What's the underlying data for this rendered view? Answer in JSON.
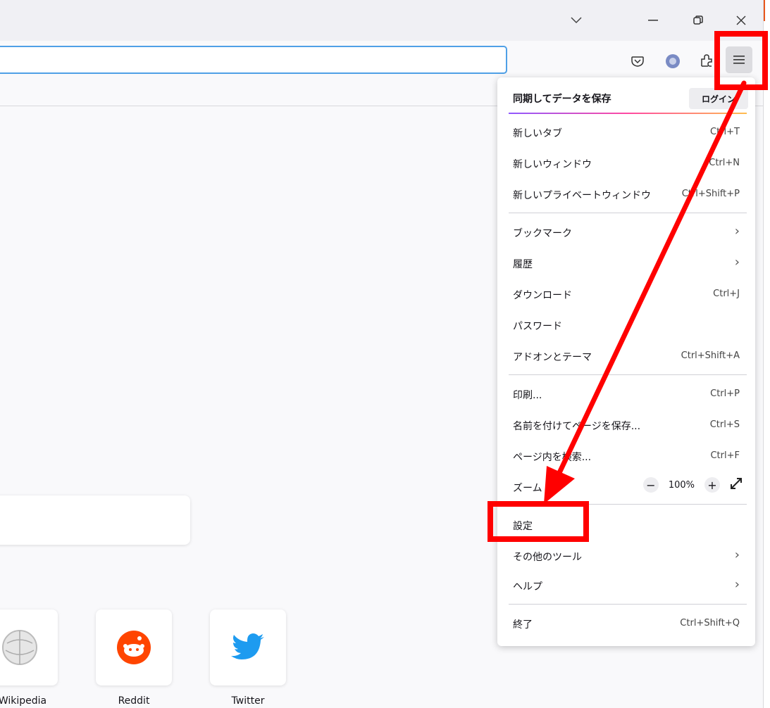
{
  "window": {
    "controls": {
      "dropdown": "chevron-down-icon",
      "minimize": "minimize-icon",
      "restore": "restore-icon",
      "close": "close-icon"
    }
  },
  "toolbar": {
    "icons": [
      "pocket-icon",
      "account-icon",
      "extensions-icon",
      "hamburger-menu-icon"
    ]
  },
  "app_menu": {
    "sync": {
      "label": "同期してデータを保存",
      "login_button": "ログイン"
    },
    "items_group1": [
      {
        "label": "新しいタブ",
        "shortcut": "Ctrl+T"
      },
      {
        "label": "新しいウィンドウ",
        "shortcut": "Ctrl+N"
      },
      {
        "label": "新しいプライベートウィンドウ",
        "shortcut": "Ctrl+Shift+P"
      }
    ],
    "items_group2": [
      {
        "label": "ブックマーク",
        "submenu": true
      },
      {
        "label": "履歴",
        "submenu": true
      },
      {
        "label": "ダウンロード",
        "shortcut": "Ctrl+J"
      },
      {
        "label": "パスワード",
        "shortcut": ""
      },
      {
        "label": "アドオンとテーマ",
        "shortcut": "Ctrl+Shift+A"
      }
    ],
    "items_group3": [
      {
        "label": "印刷...",
        "shortcut": "Ctrl+P"
      },
      {
        "label": "名前を付けてページを保存...",
        "shortcut": "Ctrl+S"
      },
      {
        "label": "ページ内を検索...",
        "shortcut": "Ctrl+F"
      }
    ],
    "zoom": {
      "label": "ズーム",
      "minus": "−",
      "value": "100%",
      "plus": "+",
      "fullscreen_icon": "fullscreen-icon"
    },
    "items_group4": [
      {
        "label": "設定",
        "submenu": false
      },
      {
        "label": "その他のツール",
        "submenu": true
      },
      {
        "label": "ヘルプ",
        "submenu": true
      }
    ],
    "exit": {
      "label": "終了",
      "shortcut": "Ctrl+Shift+Q"
    }
  },
  "top_sites": [
    {
      "label": "Wikipedia",
      "icon": "wikipedia-icon"
    },
    {
      "label": "Reddit",
      "icon": "reddit-icon"
    },
    {
      "label": "Twitter",
      "icon": "twitter-icon"
    }
  ],
  "colors": {
    "highlight": "#ff0000",
    "accent": "#4fa0e6"
  }
}
